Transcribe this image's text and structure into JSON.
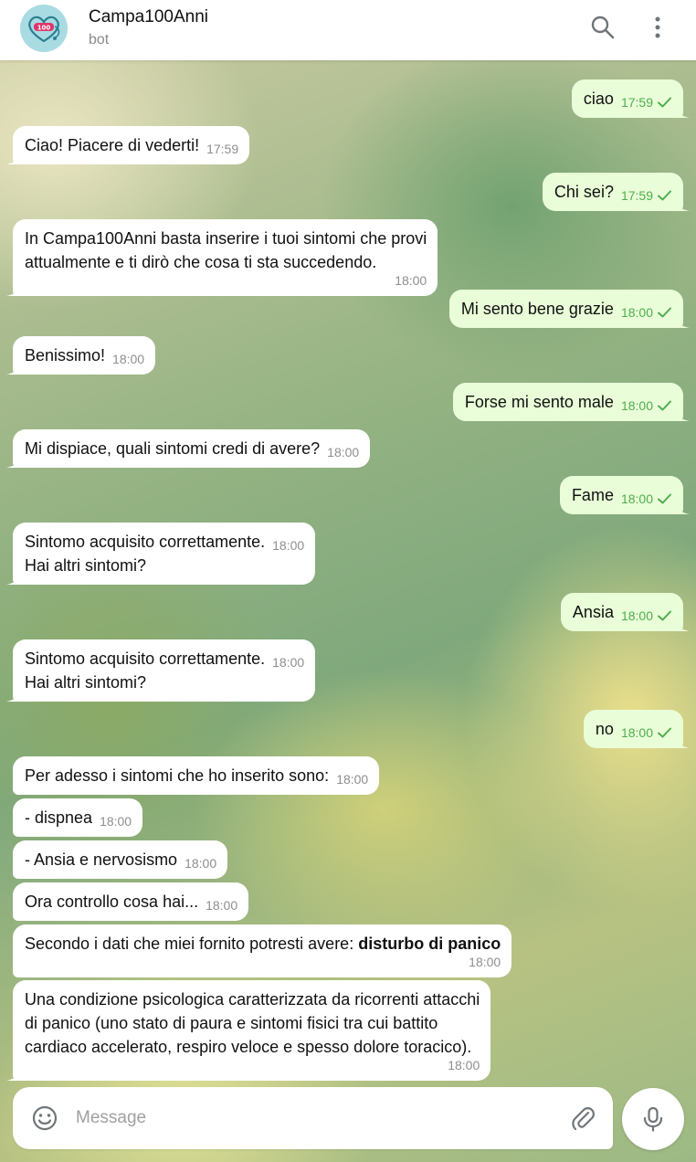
{
  "header": {
    "title": "Campa100Anni",
    "subtitle": "bot",
    "avatar_text": "100"
  },
  "messages": [
    {
      "dir": "out",
      "text": "ciao",
      "time": "17:59"
    },
    {
      "dir": "in",
      "text": "Ciao! Piacere di vederti!",
      "time": "17:59"
    },
    {
      "dir": "out",
      "text": "Chi sei?",
      "time": "17:59"
    },
    {
      "dir": "in",
      "text": "In Campa100Anni basta inserire i tuoi sintomi che provi\nattualmente e ti dirò che cosa ti sta succedendo.",
      "time": "18:00"
    },
    {
      "dir": "out",
      "text": "Mi sento bene grazie",
      "time": "18:00"
    },
    {
      "dir": "in",
      "text": "Benissimo!",
      "time": "18:00"
    },
    {
      "dir": "out",
      "text": "Forse mi sento male",
      "time": "18:00"
    },
    {
      "dir": "in",
      "text": "Mi dispiace, quali sintomi credi di avere?",
      "time": "18:00"
    },
    {
      "dir": "out",
      "text": "Fame",
      "time": "18:00"
    },
    {
      "dir": "in",
      "text": "Sintomo acquisito correttamente.\nHai altri sintomi?",
      "time": "18:00"
    },
    {
      "dir": "out",
      "text": "Ansia",
      "time": "18:00"
    },
    {
      "dir": "in",
      "text": "Sintomo acquisito correttamente.\nHai altri sintomi?",
      "time": "18:00"
    },
    {
      "dir": "out",
      "text": "no",
      "time": "18:00"
    },
    {
      "dir": "in",
      "text": "Per adesso i sintomi che ho inserito sono:",
      "time": "18:00"
    },
    {
      "dir": "in",
      "text": "- dispnea",
      "time": "18:00"
    },
    {
      "dir": "in",
      "text": "- Ansia e nervosismo",
      "time": "18:00"
    },
    {
      "dir": "in",
      "text": "Ora controllo cosa hai...",
      "time": "18:00"
    },
    {
      "dir": "in",
      "text": "Secondo i dati che miei fornito potresti avere: ",
      "bold": "disturbo di panico",
      "time": "18:00"
    },
    {
      "dir": "in",
      "text": "Una condizione psicologica caratterizzata da ricorrenti attacchi\ndi panico (uno stato di paura e sintomi fisici tra cui battito\ncardiaco accelerato, respiro veloce e spesso dolore toracico).",
      "time": "18:00"
    }
  ],
  "composer": {
    "placeholder": "Message"
  },
  "icons": {
    "search": "search-icon",
    "menu": "more-vertical-icon",
    "emoji": "emoji-icon",
    "attach": "paperclip-icon",
    "mic": "microphone-icon",
    "read": "check-icon"
  },
  "colors": {
    "outgoing_bubble": "#e9fdd8",
    "incoming_bubble": "#ffffff",
    "read_check": "#4fae4e"
  }
}
